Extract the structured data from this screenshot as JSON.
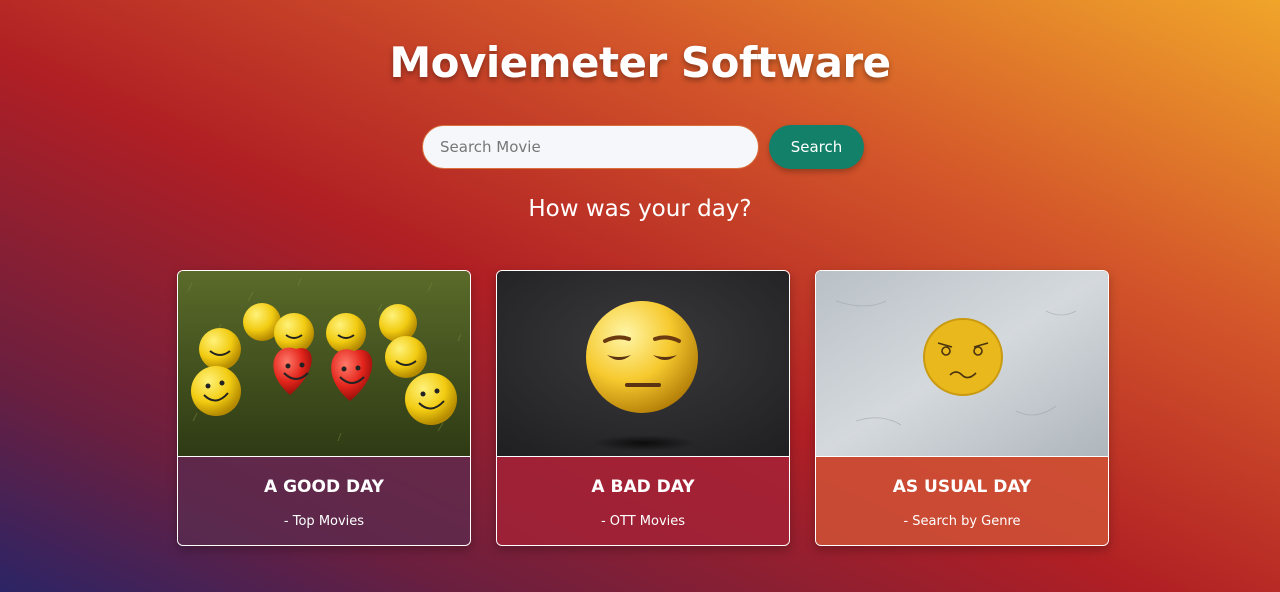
{
  "header": {
    "title": "Moviemeter Software"
  },
  "search": {
    "placeholder": "Search Movie",
    "button_label": "Search"
  },
  "prompt": {
    "text": "How was your day?"
  },
  "cards": [
    {
      "title": "A GOOD DAY",
      "subtitle": "- Top Movies",
      "image_icon": "smiley-balls-image"
    },
    {
      "title": "A BAD DAY",
      "subtitle": "- OTT Movies",
      "image_icon": "sad-emoji-image"
    },
    {
      "title": "AS USUAL DAY",
      "subtitle": "- Search by Genre",
      "image_icon": "frowning-face-image"
    }
  ],
  "colors": {
    "button": "#13806a",
    "gradient_start": "#2c2466",
    "gradient_mid": "#b01f24",
    "gradient_end": "#f0a52a"
  }
}
